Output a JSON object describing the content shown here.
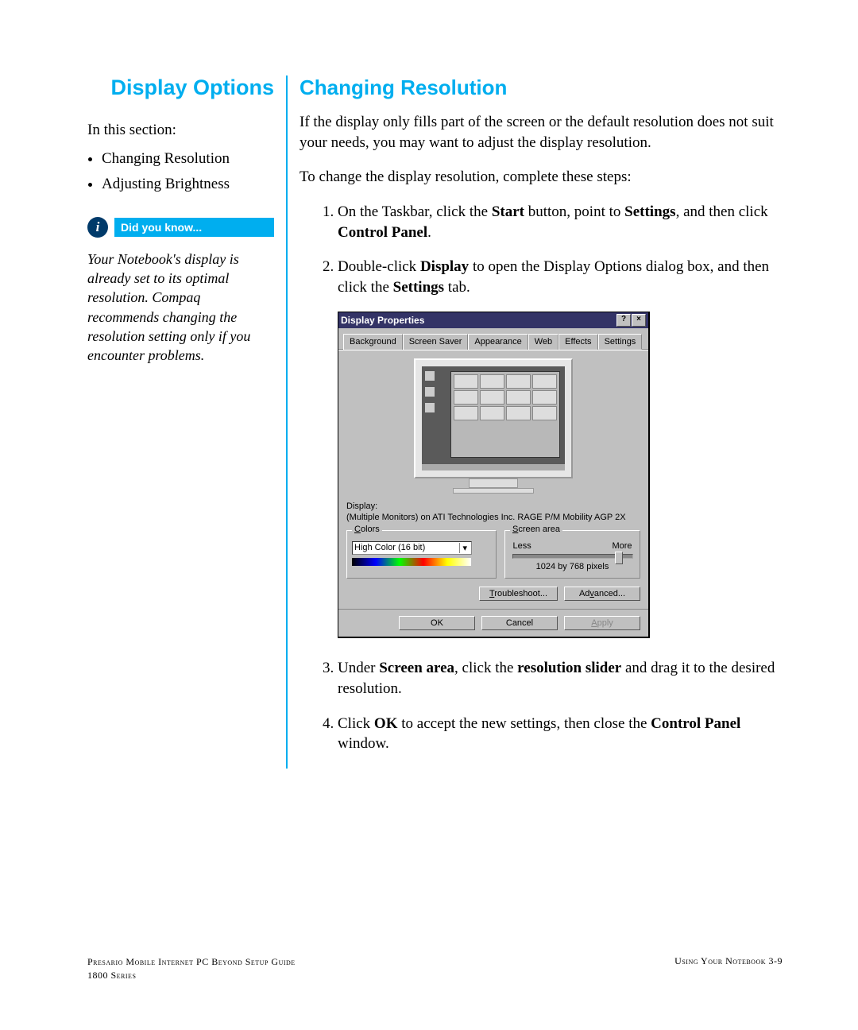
{
  "left": {
    "title": "Display Options",
    "in_section_label": "In this section:",
    "bullets": [
      "Changing Resolution",
      "Adjusting Brightness"
    ],
    "dyk_icon": "i",
    "dyk_label": "Did you know...",
    "dyk_body": "Your Notebook's display is already set to its optimal resolution. Compaq recommends changing the resolution setting only if you encounter problems."
  },
  "right": {
    "title": "Changing Resolution",
    "intro1": "If the display only fills part of the screen or the default resolution does not suit your needs, you may want to adjust the display resolution.",
    "intro2": "To change the display resolution, complete these steps:",
    "step1_a": "On the Taskbar, click the ",
    "step1_b": "Start",
    "step1_c": " button, point to ",
    "step1_d": "Settings",
    "step1_e": ", and then click ",
    "step1_f": "Control Panel",
    "step1_g": ".",
    "step2_a": "Double-click ",
    "step2_b": "Display",
    "step2_c": " to open the Display Options dialog box, and then click the ",
    "step2_d": "Settings",
    "step2_e": " tab.",
    "step3_a": "Under ",
    "step3_b": "Screen area",
    "step3_c": ", click the ",
    "step3_d": "resolution slider",
    "step3_e": " and drag it to the desired resolution.",
    "step4_a": "Click ",
    "step4_b": "OK",
    "step4_c": " to accept the new settings, then close the ",
    "step4_d": "Control Panel",
    "step4_e": " window."
  },
  "dialog": {
    "title": "Display Properties",
    "help_btn": "?",
    "close_btn": "×",
    "tabs": [
      "Background",
      "Screen Saver",
      "Appearance",
      "Web",
      "Effects",
      "Settings"
    ],
    "active_tab": 5,
    "display_label": "Display:",
    "display_info": "(Multiple Monitors) on ATI Technologies Inc. RAGE P/M Mobility AGP 2X",
    "colors_legend": "Colors",
    "colors_u": "C",
    "colors_value": "High Color (16 bit)",
    "screen_legend": "Screen area",
    "screen_u": "S",
    "less": "Less",
    "more": "More",
    "resolution": "1024 by 768 pixels",
    "troubleshoot": "Troubleshoot...",
    "troubleshoot_u": "T",
    "advanced": "Advanced...",
    "advanced_u": "v",
    "ok": "OK",
    "cancel": "Cancel",
    "apply": "Apply",
    "apply_u": "A"
  },
  "footer": {
    "left1": "Presario Mobile Internet PC Beyond Setup Guide",
    "left2": "1800 Series",
    "right": "Using Your Notebook   3-9"
  }
}
